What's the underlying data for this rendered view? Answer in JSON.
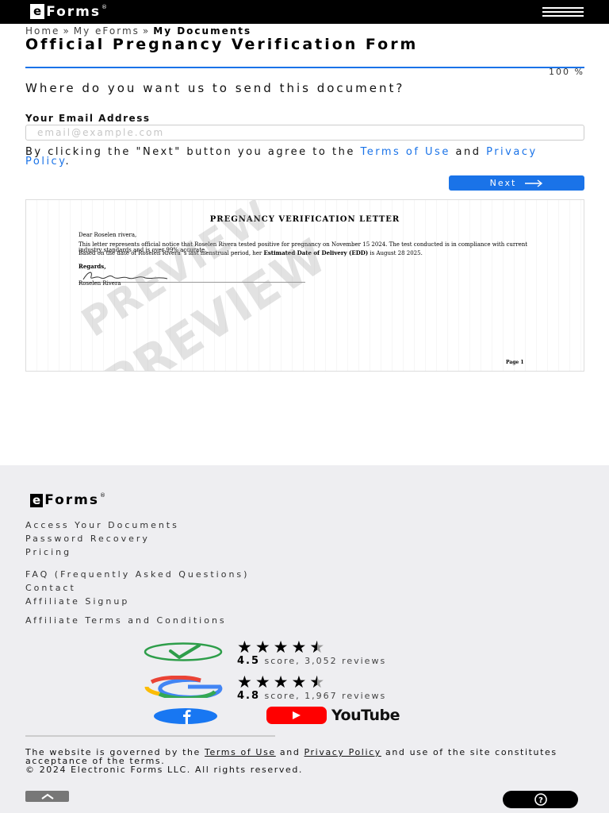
{
  "header": {
    "logo_e": "e",
    "logo_forms": "Forms",
    "logo_reg": "®"
  },
  "breadcrumb": {
    "items": [
      "Home",
      "My eForms",
      "My Documents"
    ],
    "separator": "»"
  },
  "page": {
    "title": "Official Pregnancy Verification Form",
    "progress_percent": 100,
    "progress_label": "100 %"
  },
  "form": {
    "question": "Where do you want us to send this document?",
    "email_label": "Your Email Address",
    "email_value": "",
    "email_placeholder": "email@example.com",
    "agree_prefix": "By clicking the \"Next\" button you agree to the",
    "terms_link": "Terms of Use",
    "and_text": "and",
    "privacy_link": "Privacy Policy",
    "period": ".",
    "next_label": "Next"
  },
  "preview": {
    "doc_title": "PREGNANCY VERIFICATION LETTER",
    "salutation": "Dear Roselen rivera,",
    "para1": "This letter represents official notice that Roselen Rivera  tested positive for pregnancy on November 15 2024. The test conducted is in compliance with current industry standards and is over 99% accurate.",
    "para2_prefix": "Based on the date of Roselen Rivera 's last menstrual period, her",
    "para2_bold": "Estimated Date of Delivery (EDD)",
    "para2_suffix": "is August 28 2025.",
    "regards": "Regards,",
    "signer": "Roselen Rivera",
    "page_label": "Page 1",
    "watermark": "PREVIEW"
  },
  "footer": {
    "links_group1": [
      "Access Your Documents",
      "Password Recovery",
      "Pricing"
    ],
    "links_group2": [
      "FAQ (Frequently Asked Questions)",
      "Contact",
      "Affiliate Signup"
    ],
    "links_group3": [
      "Affiliate Terms and Conditions"
    ],
    "ratings": [
      {
        "source_icon": "check-badge-icon",
        "score": "4.5",
        "text": "score, 3,052 reviews",
        "stars": 4.5
      },
      {
        "source_icon": "google-icon",
        "score": "4.8",
        "text": "score, 1,967 reviews",
        "stars": 4.5
      }
    ],
    "social": {
      "facebook_icon": "facebook-icon",
      "youtube_label": "YouTube"
    },
    "legal_prefix": "The website is governed by the",
    "legal_terms": "Terms of Use",
    "legal_and": "and",
    "legal_privacy": "Privacy Policy",
    "legal_suffix": "and use of the site constitutes acceptance of the terms.",
    "copyright": "© 2024 Electronic Forms LLC. All rights reserved."
  },
  "colors": {
    "accent": "#1a73e8",
    "header_bg": "#000000",
    "footer_bg": "#eeeef1",
    "trustpilot_green": "#2e9e4a",
    "youtube_red": "#ff0000",
    "facebook_blue": "#1877f2"
  }
}
